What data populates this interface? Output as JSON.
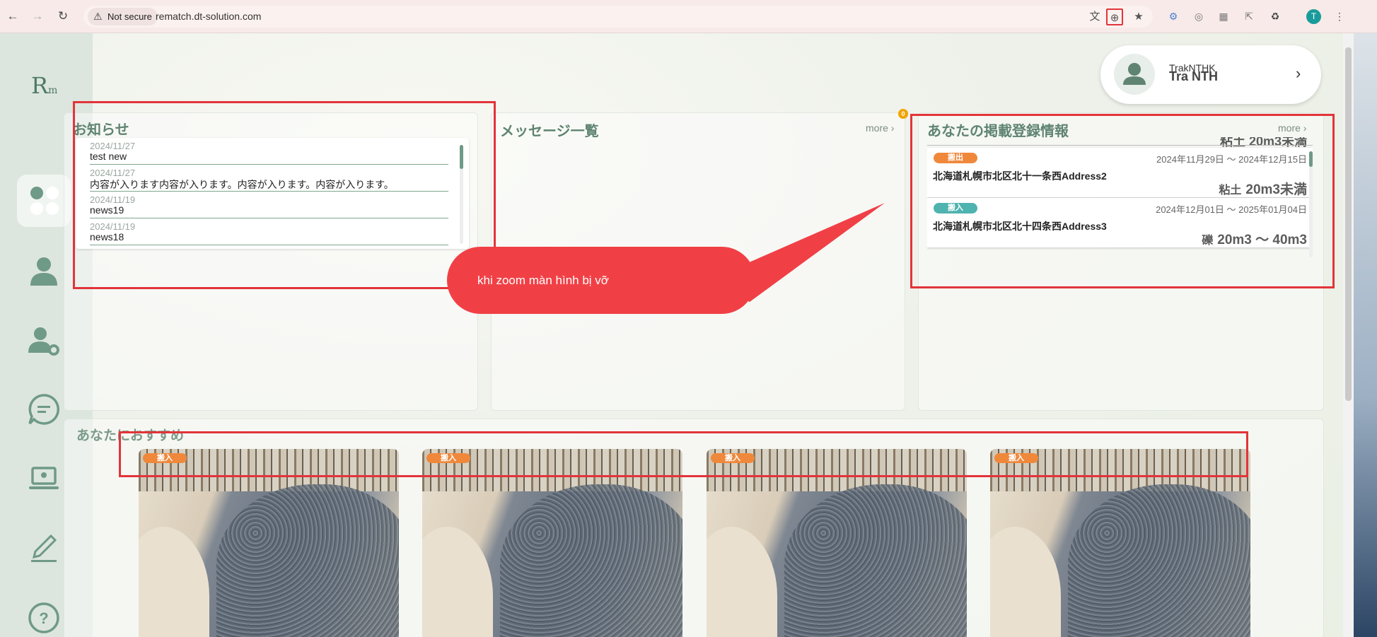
{
  "browser": {
    "security_label": "Not secure",
    "url": "rematch.dt-solution.com",
    "profile_initial": "T"
  },
  "user": {
    "id_line": "TrakNTHK",
    "name": "Tra NTH"
  },
  "news": {
    "title": "お知らせ",
    "items": [
      {
        "date": "2024/11/27",
        "text": "test new"
      },
      {
        "date": "2024/11/27",
        "text": "内容が入ります内容が入ります。内容が入ります。内容が入ります。"
      },
      {
        "date": "2024/11/19",
        "text": "news19"
      },
      {
        "date": "2024/11/19",
        "text": "news18"
      }
    ]
  },
  "messages": {
    "title": "メッセージ一覧",
    "more": "more",
    "unread_count": "0"
  },
  "listings": {
    "title": "あなたの掲載登録情報",
    "more": "more",
    "partial_amount": "粘土 20m3未満",
    "items": [
      {
        "badge": "搬出",
        "badge_color": "#f0883c",
        "date_range": "2024年11月29日 〜 2024年12月15日",
        "address": "北海道札幌市北区北十一条西Address2",
        "kind": "粘土",
        "amount": "20m3未満"
      },
      {
        "badge": "搬入",
        "badge_color": "#4fb3b0",
        "date_range": "2024年12月01日 〜 2025年01月04日",
        "address": "北海道札幌市北区北十四条西Address3",
        "kind": "礫",
        "amount": "20m3 〜 40m3"
      }
    ]
  },
  "callout": {
    "text": "khi zoom màn hình bị vỡ",
    "color": "#f04046"
  },
  "recommended": {
    "title": "あなたにおすすめ",
    "cards": [
      {
        "badge": "搬入"
      },
      {
        "badge": "搬入"
      },
      {
        "badge": "搬入"
      },
      {
        "badge": "搬入"
      }
    ]
  },
  "colors": {
    "accent": "#5f8471",
    "annotation_red": "#e2343a",
    "sidebar": "#dde6de"
  }
}
